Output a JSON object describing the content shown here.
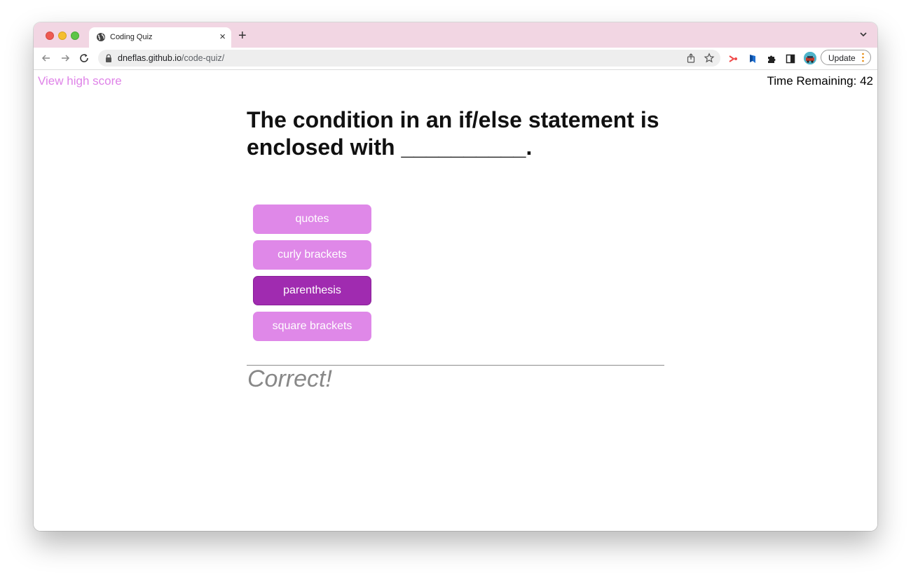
{
  "browser": {
    "tab_title": "Coding Quiz",
    "tab_close": "×",
    "new_tab": "+",
    "url_host": "dneflas.github.io",
    "url_path": "/code-quiz/",
    "update_label": "Update",
    "icons": [
      "back-icon",
      "forward-icon",
      "reload-icon",
      "lock-icon",
      "share-icon",
      "star-icon",
      "extension-icons",
      "puzzle-icon",
      "sidebar-icon",
      "avatar",
      "kebab-menu-icon",
      "chevron-down-icon"
    ]
  },
  "header": {
    "high_score_link": "View high score",
    "timer_text": "Time Remaining: 42"
  },
  "quiz": {
    "question": "The condition in an if/else statement is enclosed with __________.",
    "choices": [
      {
        "label": "quotes",
        "selected": false
      },
      {
        "label": "curly brackets",
        "selected": false
      },
      {
        "label": "parenthesis",
        "selected": true
      },
      {
        "label": "square brackets",
        "selected": false
      }
    ],
    "result": "Correct!"
  },
  "colors": {
    "tab_strip": "#f2d6e3",
    "link": "#df83e8",
    "choice": "#df88e8",
    "choice_selected": "#a02bb0",
    "result_text": "#888888"
  }
}
